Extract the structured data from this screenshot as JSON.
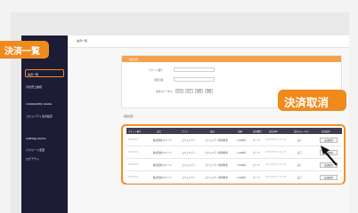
{
  "callouts": {
    "sidebar_highlight": "決済一覧",
    "cancel_highlight": "決済取消"
  },
  "sidebar": {
    "items": [
      {
        "label": "決済一覧",
        "active": true
      },
      {
        "label": "月次売上確認"
      },
      {
        "label": "community menu",
        "heading": true
      },
      {
        "label": "コミュニティ決済設定"
      },
      {
        "label": "setting menu",
        "heading": true
      },
      {
        "label": "パスワード変更"
      },
      {
        "label": "ログアウト"
      }
    ]
  },
  "header": {
    "title": "決済一覧"
  },
  "search": {
    "section_title": "検索条件",
    "fields": [
      {
        "label": "チケット番号"
      },
      {
        "label": "決済日時"
      }
    ],
    "status_label": "決済ステータス",
    "status_options": [
      "すべて",
      "完了",
      "取消",
      "失敗"
    ]
  },
  "results": {
    "label": "検索結果",
    "columns": [
      "チケット番号",
      "会社",
      "プラン",
      "商品",
      "金額",
      "決済種別",
      "決済日時",
      "決済ステータス",
      "決済取消"
    ],
    "rows": [
      {
        "ticket": "0000001",
        "company": "株式会社スキージ",
        "plan": "コミュニティ",
        "product": "コミュニティ利用料金",
        "amount": "1,000円",
        "type": "カード",
        "date": "2020/06/10 10:00",
        "status": "完了",
        "action": "決済取消"
      },
      {
        "ticket": "0000002",
        "company": "株式会社スキージ",
        "plan": "コミュニティ",
        "product": "コミュニティ利用料金",
        "amount": "1,000円",
        "type": "カード",
        "date": "2020/06/10 10:00",
        "status": "完了",
        "action": "決済取消"
      },
      {
        "ticket": "0000003",
        "company": "株式会社スキージ",
        "plan": "コミュニティ",
        "product": "コミュニティ利用料金",
        "amount": "1,000円",
        "type": "カード",
        "date": "2020/06/10 10:00",
        "status": "完了",
        "action": "決済取消"
      },
      {
        "ticket": "0000004",
        "company": "株式会社スキージ",
        "plan": "コミュニティ",
        "product": "コミュニティ利用料金",
        "amount": "1,000円",
        "type": "カード",
        "date": "2020/06/10 10:00",
        "status": "完了",
        "action": "決済取消"
      }
    ]
  },
  "colors": {
    "accent": "#f08a1c",
    "sidebar": "#1c1c36",
    "table_header": "#3d3d4d"
  }
}
